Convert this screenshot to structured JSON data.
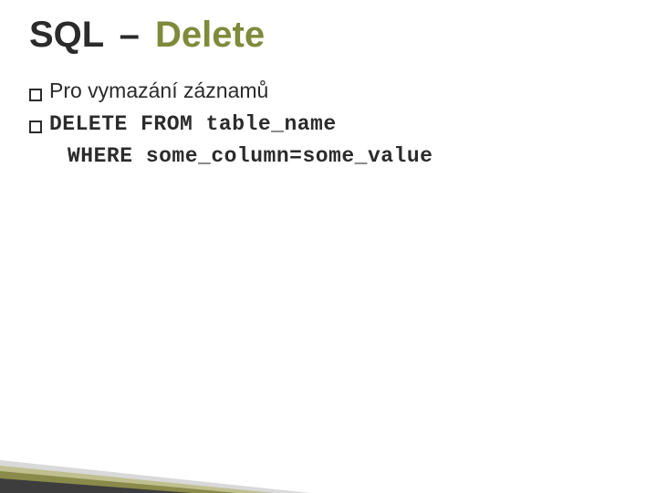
{
  "title": {
    "part1": "SQL",
    "dash": "–",
    "part2": "Delete"
  },
  "bullets": {
    "intro": "Pro vymazání záznamů",
    "sql_line1": "DELETE FROM table_name",
    "sql_line2": "WHERE some_column=some_value"
  }
}
